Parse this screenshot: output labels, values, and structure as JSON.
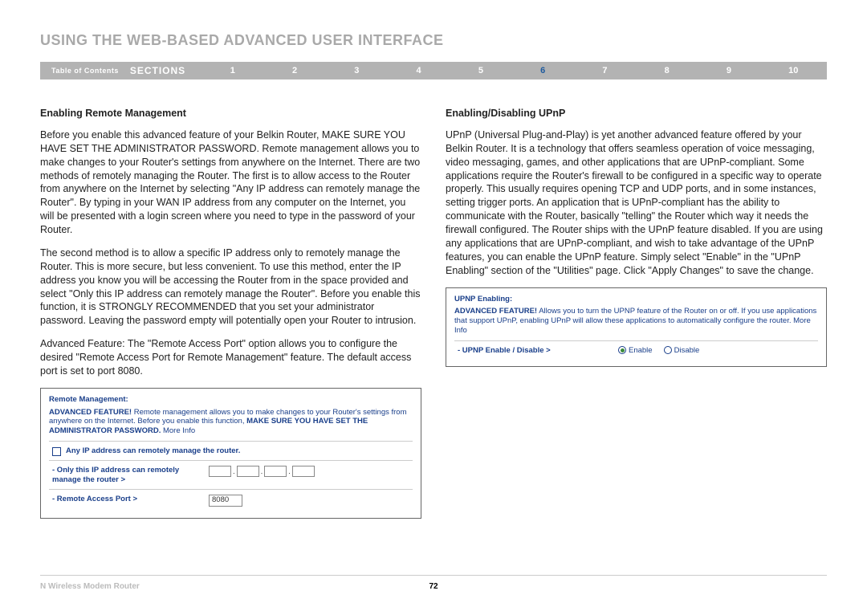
{
  "page_title": "USING THE WEB-BASED ADVANCED USER INTERFACE",
  "nav": {
    "toc": "Table of Contents",
    "sections": "SECTIONS",
    "nums": [
      "1",
      "2",
      "3",
      "4",
      "5",
      "6",
      "7",
      "8",
      "9",
      "10"
    ],
    "active": "6"
  },
  "left": {
    "heading": "Enabling Remote Management",
    "p1": "Before you enable this advanced feature of your Belkin Router, MAKE SURE YOU HAVE SET THE ADMINISTRATOR PASSWORD. Remote management allows you to make changes to your Router's settings from anywhere on the Internet. There are two methods of remotely managing the Router. The first is to allow access to the Router from anywhere on the Internet by selecting \"Any IP address can remotely manage the Router\". By typing in your WAN IP address from any computer on the Internet, you will be presented with a login screen where you need to type in the password of your Router.",
    "p2": "The second method is to allow a specific IP address only to remotely manage the Router. This is more secure, but less convenient. To use this method, enter the IP address you know you will be accessing the Router from in the space provided and select \"Only this IP address can remotely manage the Router\". Before you enable this function, it is STRONGLY RECOMMENDED that you set your administrator password. Leaving the password empty will potentially open your Router to intrusion.",
    "p3": "Advanced Feature: The \"Remote Access Port\" option allows you to configure the desired \"Remote Access Port for Remote Management\" feature. The default access port is set to port 8080."
  },
  "right": {
    "heading": "Enabling/Disabling UPnP",
    "p1": "UPnP (Universal Plug-and-Play) is yet another advanced feature offered by your Belkin Router. It is a technology that offers seamless operation of voice messaging, video messaging, games, and other applications that are UPnP-compliant. Some applications require the Router's firewall to be configured in a specific way to operate properly. This usually requires opening TCP and UDP ports, and in some instances, setting trigger ports. An application that is UPnP-compliant has the ability to communicate with the Router, basically \"telling\" the Router which way it needs the firewall configured. The Router ships with the UPnP feature disabled. If you are using any applications that are UPnP-compliant, and wish to take advantage of the UPnP features, you can enable the UPnP feature. Simply select \"Enable\" in the \"UPnP Enabling\" section of the \"Utilities\" page. Click \"Apply Changes\" to save the change."
  },
  "remote_panel": {
    "title": "Remote Management:",
    "desc_prefix": "ADVANCED FEATURE!",
    "desc": " Remote management allows you to make changes to your Router's settings from anywhere on the Internet. Before you enable this function, ",
    "desc_bold": "MAKE SURE YOU HAVE SET THE ADMINISTRATOR PASSWORD.",
    "more": "More Info",
    "row1": "Any IP address can remotely manage the router.",
    "row2": "- Only this IP address can remotely manage the router >",
    "row3": "- Remote Access Port >",
    "port_value": "8080"
  },
  "upnp_panel": {
    "title": "UPNP Enabling:",
    "desc_prefix": "ADVANCED FEATURE!",
    "desc": " Allows you to turn the UPNP feature of the Router on or off. If you use applications that support UPnP, enabling UPnP will allow these applications to automatically configure the router. ",
    "more": "More Info",
    "row_label": "- UPNP Enable / Disable >",
    "opt_enable": "Enable",
    "opt_disable": "Disable"
  },
  "footer": {
    "left": "N Wireless Modem Router",
    "center": "72"
  }
}
